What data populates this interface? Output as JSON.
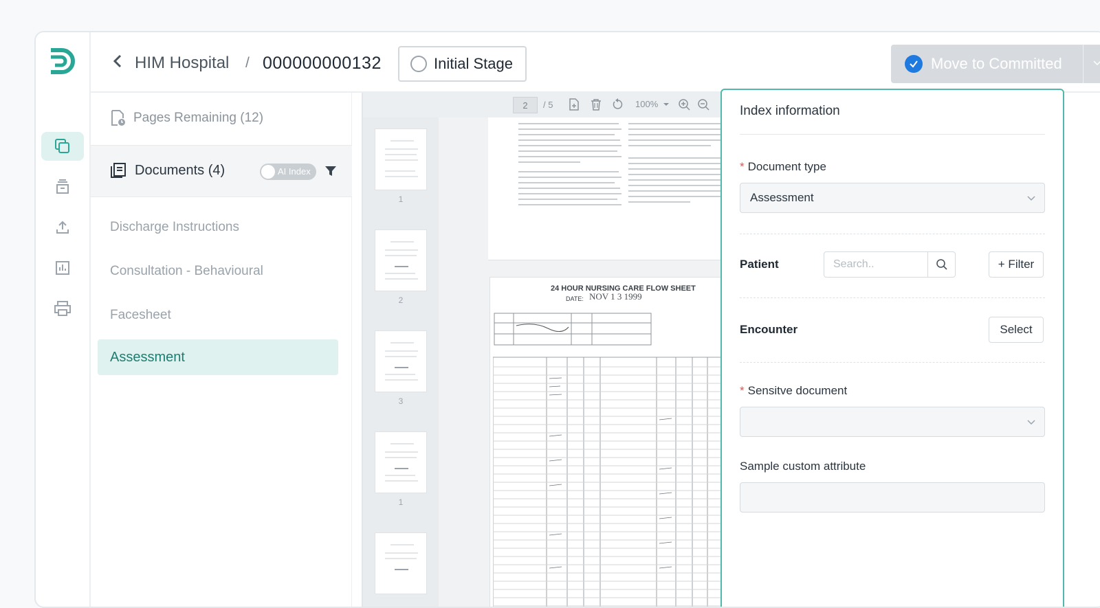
{
  "header": {
    "hospital": "HIM Hospital",
    "separator": "/",
    "record_id": "000000000132",
    "stage_label": "Initial Stage",
    "commit_label": "Move to Committed"
  },
  "left_panel": {
    "pages_remaining": "Pages Remaining (12)",
    "documents_title": "Documents (4)",
    "ai_index_label": "AI Index",
    "documents": [
      "Discharge Instructions",
      "Consultation - Behavioural",
      "Facesheet",
      "Assessment"
    ],
    "selected_document": "Assessment"
  },
  "viewer": {
    "current_page": "2",
    "page_total": "/ 5",
    "zoom": "100%",
    "thumbnail_numbers": [
      "1",
      "2",
      "3",
      "1"
    ],
    "page2_title": "24 HOUR NURSING CARE FLOW SHEET",
    "page2_date_label": "DATE:",
    "page2_date_value": "NOV 1 3 1999"
  },
  "index_panel": {
    "title": "Index information",
    "document_type_label": "Document type",
    "document_type_value": "Assessment",
    "patient_label": "Patient",
    "patient_search_placeholder": "Search..",
    "filter_button": "+ Filter",
    "encounter_label": "Encounter",
    "encounter_button": "Select",
    "sensitive_label": "Sensitve document",
    "sensitive_value": "",
    "custom_attr_label": "Sample custom attribute",
    "custom_attr_value": ""
  },
  "colors": {
    "brand_teal": "#2aa696",
    "selection_bg": "#dff2ef",
    "commit_check": "#1f7ae0",
    "panel_border": "#4fb8aa",
    "required": "#e05555"
  },
  "icons": {
    "rail": [
      "documents-icon",
      "archive-icon",
      "upload-icon",
      "report-chart-icon",
      "printer-icon"
    ]
  }
}
